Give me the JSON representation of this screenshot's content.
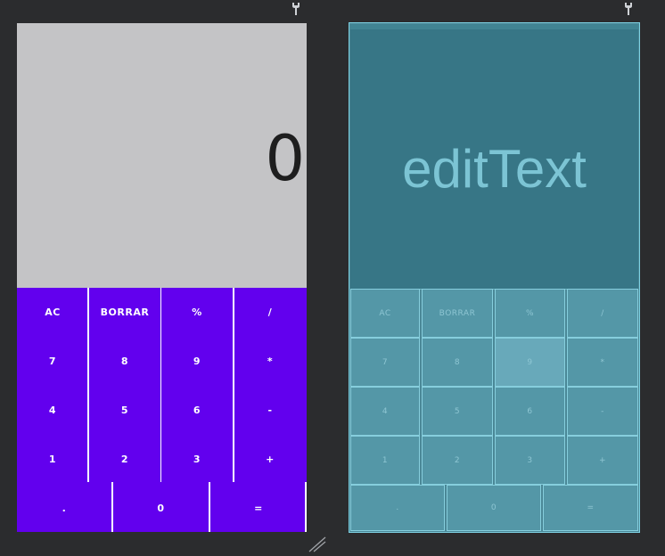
{
  "display": {
    "value": "0",
    "placeholder": "editText"
  },
  "keypad": {
    "rows": [
      [
        "AC",
        "BORRAR",
        "%",
        "/"
      ],
      [
        "7",
        "8",
        "9",
        "*"
      ],
      [
        "4",
        "5",
        "6",
        "-"
      ],
      [
        "1",
        "2",
        "3",
        "+"
      ],
      [
        ".",
        "0",
        "="
      ]
    ]
  },
  "colors": {
    "accent": "#6200ee",
    "display_bg": "#c4c4c6",
    "blueprint_bg": "#377686",
    "canvas_bg": "#2b2c2e"
  },
  "icons": {
    "design_toolbar": "wrench-icon",
    "blueprint_toolbar": "wrench-icon",
    "resize": "resize-handle-icon"
  }
}
